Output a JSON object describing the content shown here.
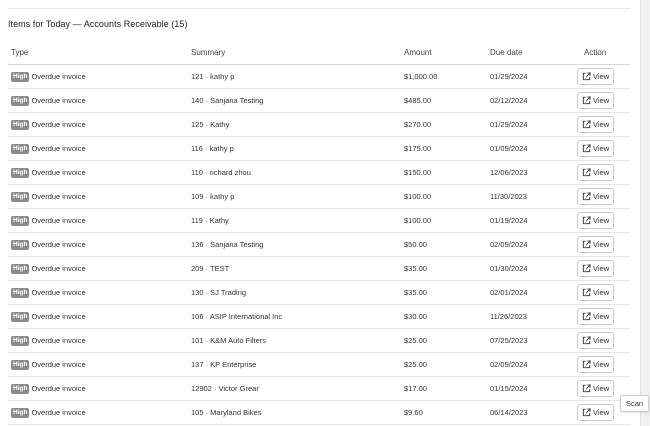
{
  "section": {
    "title": "Items for Today — Accounts Receivable (15)"
  },
  "table": {
    "headers": {
      "type": "Type",
      "summary": "Summary",
      "amount": "Amount",
      "due_date": "Due date",
      "action": "Action"
    },
    "rows": [
      {
        "priority": "High",
        "type": "Overdue invoice",
        "summary": "121 · kathy p",
        "amount": "$1,000.00",
        "due": "01/29/2024",
        "action": "View"
      },
      {
        "priority": "High",
        "type": "Overdue invoice",
        "summary": "140 · Sanjana Testing",
        "amount": "$485.00",
        "due": "02/12/2024",
        "action": "View"
      },
      {
        "priority": "High",
        "type": "Overdue invoice",
        "summary": "125 · Kathy",
        "amount": "$270.00",
        "due": "01/29/2024",
        "action": "View"
      },
      {
        "priority": "High",
        "type": "Overdue invoice",
        "summary": "116 · kathy p",
        "amount": "$175.00",
        "due": "01/09/2024",
        "action": "View"
      },
      {
        "priority": "High",
        "type": "Overdue invoice",
        "summary": "110 · richard zhou",
        "amount": "$150.00",
        "due": "12/06/2023",
        "action": "View"
      },
      {
        "priority": "High",
        "type": "Overdue invoice",
        "summary": "109 · kathy p",
        "amount": "$100.00",
        "due": "11/30/2023",
        "action": "View"
      },
      {
        "priority": "High",
        "type": "Overdue invoice",
        "summary": "119 · Kathy",
        "amount": "$100.00",
        "due": "01/19/2024",
        "action": "View"
      },
      {
        "priority": "High",
        "type": "Overdue invoice",
        "summary": "136 · Sanjana Testing",
        "amount": "$50.00",
        "due": "02/09/2024",
        "action": "View"
      },
      {
        "priority": "High",
        "type": "Overdue invoice",
        "summary": "209 · TEST",
        "amount": "$35.00",
        "due": "01/30/2024",
        "action": "View"
      },
      {
        "priority": "High",
        "type": "Overdue invoice",
        "summary": "130 · SJ Trading",
        "amount": "$35.00",
        "due": "02/01/2024",
        "action": "View"
      },
      {
        "priority": "High",
        "type": "Overdue invoice",
        "summary": "106 · ASIP International Inc",
        "amount": "$30.00",
        "due": "11/26/2023",
        "action": "View"
      },
      {
        "priority": "High",
        "type": "Overdue invoice",
        "summary": "101 · K&M Auto Filters",
        "amount": "$25.00",
        "due": "07/25/2023",
        "action": "View"
      },
      {
        "priority": "High",
        "type": "Overdue invoice",
        "summary": "137 · KP Enterprise",
        "amount": "$25.00",
        "due": "02/09/2024",
        "action": "View"
      },
      {
        "priority": "High",
        "type": "Overdue invoice",
        "summary": "12902 · Victor Grear",
        "amount": "$17.00",
        "due": "01/15/2024",
        "action": "View"
      },
      {
        "priority": "High",
        "type": "Overdue invoice",
        "summary": "105 · Maryland Bikes",
        "amount": "$9.60",
        "due": "06/14/2023",
        "action": "View"
      }
    ]
  },
  "scan_button": {
    "label": "Scan"
  },
  "colors": {
    "badge_bg": "#8a8a8a",
    "row_border": "#e5e5e5"
  },
  "icons": {
    "view": "external-link-icon"
  }
}
